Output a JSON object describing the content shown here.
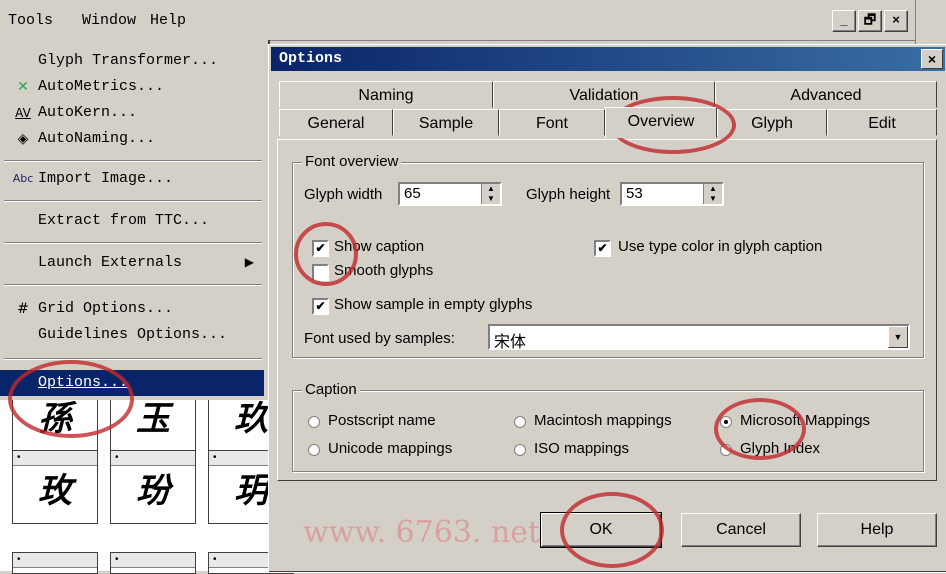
{
  "menubar": {
    "tools": "Tools",
    "window": "Window",
    "help": "Help",
    "min": "_",
    "restore": "🗗",
    "close": "×"
  },
  "toolsmenu": {
    "items": [
      {
        "label": "Glyph Transformer...",
        "icon": ""
      },
      {
        "label": "AutoMetrics...",
        "icon": "✕"
      },
      {
        "label": "AutoKern...",
        "icon": "AV"
      },
      {
        "label": "AutoNaming...",
        "icon": "◈"
      },
      {
        "label": "Import Image...",
        "icon": "Abc"
      },
      {
        "label": "Extract from TTC...",
        "icon": ""
      },
      {
        "label": "Launch Externals",
        "icon": ""
      },
      {
        "label": "Grid Options...",
        "icon": "#"
      },
      {
        "label": "Guidelines Options...",
        "icon": ""
      },
      {
        "label": "Options...",
        "icon": ""
      }
    ]
  },
  "glyphs": [
    "孫",
    "玉",
    "玖",
    "玫",
    "玢",
    "玥"
  ],
  "dialog": {
    "title": "Options",
    "tabs_back": [
      "Naming",
      "Validation",
      "Advanced"
    ],
    "tabs_front": [
      "General",
      "Sample",
      "Font",
      "Overview",
      "Glyph",
      "Edit"
    ],
    "overview": {
      "group_label": "Font overview",
      "glyph_width_label": "Glyph width",
      "glyph_width_value": "65",
      "glyph_height_label": "Glyph height",
      "glyph_height_value": "53",
      "show_caption": {
        "label": "Show caption",
        "checked": true
      },
      "smooth_glyphs": {
        "label": "Smooth glyphs",
        "checked": false
      },
      "show_sample": {
        "label": "Show sample in empty glyphs",
        "checked": true
      },
      "use_type_color": {
        "label": "Use type color in glyph caption",
        "checked": true
      },
      "font_used_label": "Font used by samples:",
      "font_used_value": "宋体"
    },
    "caption": {
      "group_label": "Caption",
      "options": [
        {
          "label": "Postscript name",
          "selected": false
        },
        {
          "label": "Macintosh mappings",
          "selected": false
        },
        {
          "label": "Microsoft Mappings",
          "selected": true
        },
        {
          "label": "Unicode mappings",
          "selected": false
        },
        {
          "label": "ISO mappings",
          "selected": false
        },
        {
          "label": "Glyph Index",
          "selected": false
        }
      ]
    },
    "buttons": {
      "ok": "OK",
      "cancel": "Cancel",
      "help": "Help"
    },
    "watermark": "www. 6763. net",
    "close": "×"
  }
}
